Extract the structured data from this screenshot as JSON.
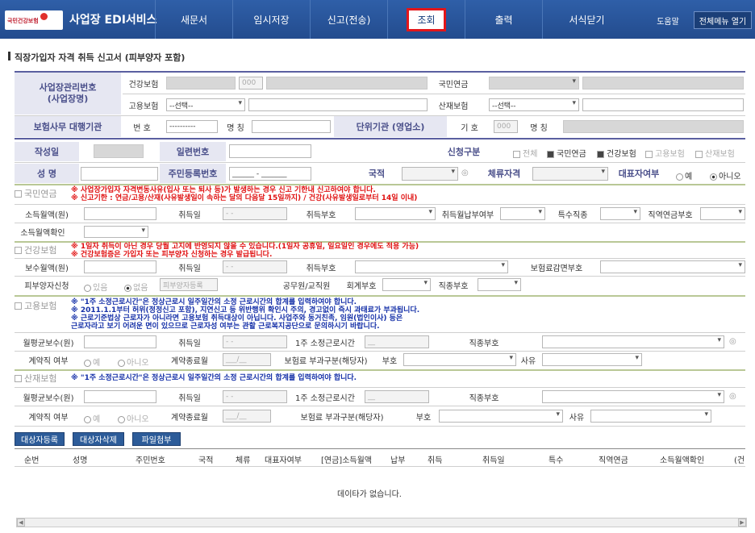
{
  "header": {
    "logo_text": "국민건강보험",
    "title": "사업장 EDI서비스",
    "menu": [
      "새문서",
      "임시저장",
      "신고(전송)",
      "조회",
      "출력",
      "서식닫기"
    ],
    "help": "도움말",
    "all_menu": "전체메뉴 열기"
  },
  "page_title": "직장가입자 자격 취득 신고서 (피부양자 포함)",
  "biz": {
    "label": "사업장관리번호\n(사업장명)",
    "health": "건강보험",
    "employ": "고용보험",
    "pension": "국민연금",
    "accident": "산재보험",
    "code": "000",
    "select": "--선택--"
  },
  "agency": {
    "label": "보험사무 대행기관",
    "num": "번 호",
    "name": "명 칭",
    "unit": "단위기관 (영업소)",
    "sym": "기 호",
    "unit_code": "000",
    "unit_name": "명 칭",
    "dash": "----------"
  },
  "form": {
    "date_label": "작성일",
    "serial_label": "일련번호",
    "apply_label": "신청구분",
    "apply_opts": [
      "전체",
      "국민연금",
      "건강보험",
      "고용보험",
      "산재보험"
    ],
    "name_label": "성 명",
    "rrn_label": "주민등록번호",
    "rrn_val": "______ - _______",
    "nation_label": "국적",
    "stay_label": "체류자격",
    "rep_label": "대표자여부",
    "yes": "예",
    "no": "아니오"
  },
  "pension": {
    "title": "국민연금",
    "note1": "※ 사업장가입자 자격변동사유(입사 또는 퇴사 등)가 발생하는 경우 신고 기한내 신고하여야 합니다.",
    "note2": "※ 신고기한 : 연금/고용/산재(사유발생일이 속하는 달의 다음달 15일까지) / 건강(사유발생일로부터 14일 이내)",
    "income": "소득월액(원)",
    "acq_date": "취득일",
    "acq_code": "취득부호",
    "pay": "취득월납부여부",
    "special": "특수직종",
    "job_pension": "직역연금부호",
    "income_check": "소득월액확인",
    "date_ph": "- -"
  },
  "health": {
    "title": "건강보험",
    "note1": "※ 1일자 취득이 아닌 경우 당월 고지에 반영되지 않을 수 있습니다.(1일자 공휴일, 일요일인 경우에도 적용 가능)",
    "note2": "※ 건강보험증은 가입자 또는 피부양자 신청하는 경우 발급됩니다.",
    "wage": "보수월액(원)",
    "acq_date": "취득일",
    "acq_code": "취득부호",
    "reduce": "보험료감면부호",
    "dependent": "피부양자신청",
    "yes": "있음",
    "no": "없음",
    "dep_reg": "피부양자등록",
    "civil": "공무원/교직원",
    "account": "회계부호",
    "job": "직종부호"
  },
  "employ": {
    "title": "고용보험",
    "note1": "※ \"1주 소정근로시간\"은 정상근로시 일주일간의  소정 근로시간의 합계를 입력하여야 합니다.",
    "note2": "※ 2011.1.1부터 허위(정정신고 포함), 지연신고 등 위반행위 확인시 주의, 경고없이 즉시 과태료가 부과됩니다.",
    "note3": "※ 근로기준법상 근로자가 아니라면 고용보험 취득대상이 아닙니다. 사업주와 동거친족, 임원(법인이사) 등은",
    "note4": "   근로자라고 보기 어려운 면이 있으므로 근로자성 여부는 관할 근로복지공단으로 문의하시기 바랍니다.",
    "wage": "월평균보수(원)",
    "acq_date": "취득일",
    "hours": "1주 소정근로시간",
    "job": "직종부호",
    "contract": "계약직 여부",
    "yes": "예",
    "no": "아니오",
    "end": "계약종료월",
    "levy": "보험료 부과구분(해당자)",
    "code": "부호",
    "reason": "사유",
    "hours_ph": "__",
    "end_ph": "___/__"
  },
  "accident": {
    "title": "산재보험",
    "note1": "※ \"1주 소정근로시간\"은 정상근로시 일주일간의  소정 근로시간의 합계를 입력하여야 합니다.",
    "wage": "월평균보수(원)",
    "acq_date": "취득일",
    "hours": "1주 소정근로시간",
    "job": "직종부호",
    "contract": "계약직 여부",
    "yes": "예",
    "no": "아니오",
    "end": "계약종료월",
    "levy": "보험료 부과구분(해당자)",
    "code": "부호",
    "reason": "사유"
  },
  "buttons": {
    "add": "대상자등록",
    "del": "대상자삭제",
    "attach": "파일첨부"
  },
  "table": {
    "headers": [
      "순번",
      "성명",
      "주민번호",
      "국적",
      "체류",
      "대표자여부",
      "[연금]소득월액",
      "납부",
      "취득",
      "취득일",
      "특수",
      "직역연금",
      "소득월액확인",
      "(건"
    ],
    "empty": "데이타가 없습니다."
  }
}
